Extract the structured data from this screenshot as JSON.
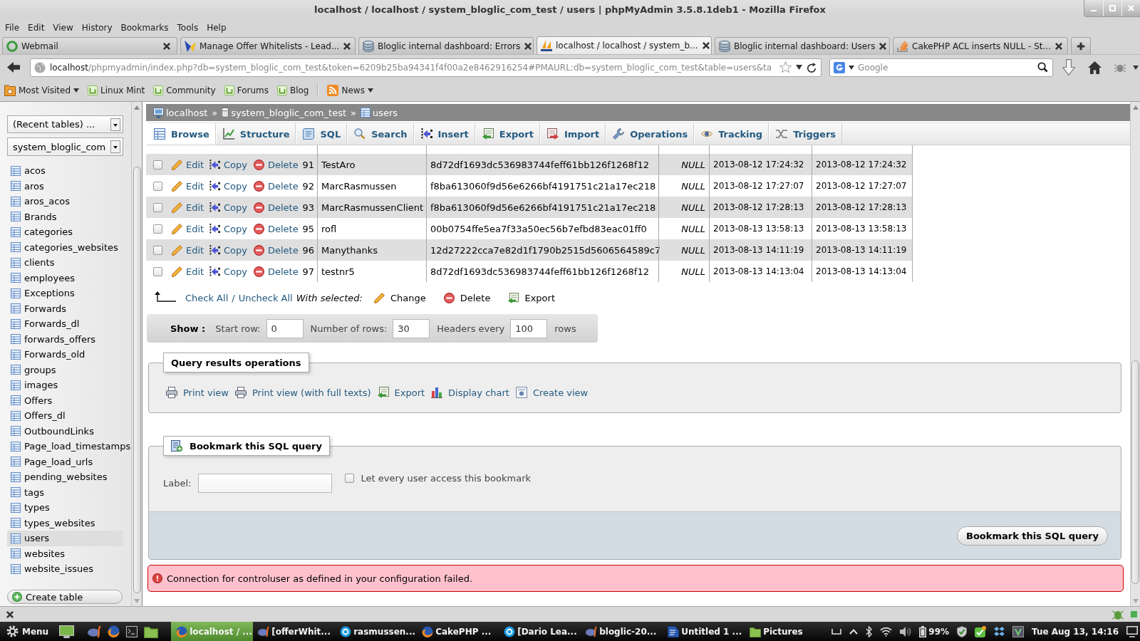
{
  "window": {
    "title": "localhost / localhost / system_bloglic_com_test / users | phpMyAdmin 3.5.8.1deb1 - Mozilla Firefox"
  },
  "menu_bar": [
    "File",
    "Edit",
    "View",
    "History",
    "Bookmarks",
    "Tools",
    "Help"
  ],
  "browser_tabs": [
    {
      "title": "Webmail",
      "selected": false
    },
    {
      "title": "Manage Offer Whitelists - Lead...",
      "selected": false
    },
    {
      "title": "Bloglic internal dashboard: Errors",
      "selected": false
    },
    {
      "title": "localhost / localhost / system_b...",
      "selected": true
    },
    {
      "title": "Bloglic internal dashboard: Users",
      "selected": false
    },
    {
      "title": "CakePHP ACL inserts NULL - St...",
      "selected": false
    }
  ],
  "address_bar": {
    "host": "localhost",
    "path": "/phpmyadmin/index.php?db=system_bloglic_com_test&token=6209b25ba94341f4f00a2e8462916254#PMAURL:db=system_bloglic_com_test&table=users&ta"
  },
  "search_bar": {
    "placeholder": "Google"
  },
  "bookmarks_bar": [
    {
      "kind": "folder",
      "label": "Most Visited"
    },
    {
      "kind": "bookmark",
      "label": "Linux Mint"
    },
    {
      "kind": "bookmark",
      "label": "Community"
    },
    {
      "kind": "bookmark",
      "label": "Forums"
    },
    {
      "kind": "bookmark",
      "label": "Blog"
    },
    {
      "kind": "separator"
    },
    {
      "kind": "feed",
      "label": "News"
    }
  ],
  "sidebar": {
    "recent_tables": "(Recent tables) ...",
    "database": "system_bloglic_com",
    "tables": [
      {
        "name": "acos",
        "selected": false
      },
      {
        "name": "aros",
        "selected": false
      },
      {
        "name": "aros_acos",
        "selected": false
      },
      {
        "name": "Brands",
        "selected": false
      },
      {
        "name": "categories",
        "selected": false
      },
      {
        "name": "categories_websites",
        "selected": false
      },
      {
        "name": "clients",
        "selected": false
      },
      {
        "name": "employees",
        "selected": false
      },
      {
        "name": "Exceptions",
        "selected": false
      },
      {
        "name": "Forwards",
        "selected": false
      },
      {
        "name": "Forwards_dl",
        "selected": false
      },
      {
        "name": "forwards_offers",
        "selected": false
      },
      {
        "name": "Forwards_old",
        "selected": false
      },
      {
        "name": "groups",
        "selected": false
      },
      {
        "name": "images",
        "selected": false
      },
      {
        "name": "Offers",
        "selected": false
      },
      {
        "name": "Offers_dl",
        "selected": false
      },
      {
        "name": "OutboundLinks",
        "selected": false
      },
      {
        "name": "Page_load_timestamps",
        "selected": false
      },
      {
        "name": "Page_load_urls",
        "selected": false
      },
      {
        "name": "pending_websites",
        "selected": false
      },
      {
        "name": "tags",
        "selected": false
      },
      {
        "name": "types",
        "selected": false
      },
      {
        "name": "types_websites",
        "selected": false
      },
      {
        "name": "users",
        "selected": true
      },
      {
        "name": "websites",
        "selected": false
      },
      {
        "name": "website_issues",
        "selected": false
      }
    ],
    "create_table": "Create table"
  },
  "breadcrumb": [
    {
      "label": "localhost"
    },
    {
      "separator": "»",
      "label": "system_bloglic_com_test"
    },
    {
      "separator": "»",
      "label": "users"
    }
  ],
  "table_tabs": [
    {
      "label": "Browse",
      "selected": true
    },
    {
      "label": "Structure",
      "selected": false
    },
    {
      "label": "SQL",
      "selected": false
    },
    {
      "label": "Search",
      "selected": false
    },
    {
      "label": "Insert",
      "selected": false
    },
    {
      "label": "Export",
      "selected": false
    },
    {
      "label": "Import",
      "selected": false
    },
    {
      "label": "Operations",
      "selected": false
    },
    {
      "label": "Tracking",
      "selected": false
    },
    {
      "label": "Triggers",
      "selected": false
    }
  ],
  "rows": [
    {
      "checked": false,
      "actions": [
        "Edit",
        "Copy",
        "Delete"
      ],
      "cells": [
        "91",
        "TestAro",
        "8d72df1693dc536983744feff61bb126f1268f12",
        "NULL",
        "2013-08-12 17:24:32",
        "2013-08-12 17:24:32"
      ]
    },
    {
      "checked": false,
      "actions": [
        "Edit",
        "Copy",
        "Delete"
      ],
      "cells": [
        "92",
        "MarcRasmussen",
        "f8ba613060f9d56e6266bf4191751c21a17ec218",
        "NULL",
        "2013-08-12 17:27:07",
        "2013-08-12 17:27:07"
      ]
    },
    {
      "checked": false,
      "actions": [
        "Edit",
        "Copy",
        "Delete"
      ],
      "cells": [
        "93",
        "MarcRasmussenClient",
        "f8ba613060f9d56e6266bf4191751c21a17ec218",
        "NULL",
        "2013-08-12 17:28:13",
        "2013-08-12 17:28:13"
      ]
    },
    {
      "checked": false,
      "actions": [
        "Edit",
        "Copy",
        "Delete"
      ],
      "cells": [
        "95",
        "rofl",
        "00b0754ffe5ea7f33a50ec56b7efbd83eac01ff0",
        "NULL",
        "2013-08-13 13:58:13",
        "2013-08-13 13:58:13"
      ]
    },
    {
      "checked": false,
      "actions": [
        "Edit",
        "Copy",
        "Delete"
      ],
      "cells": [
        "96",
        "Manythanks",
        "12d27222cca7e82d1f1790b2515d5606564589c7",
        "NULL",
        "2013-08-13 14:11:19",
        "2013-08-13 14:11:19"
      ]
    },
    {
      "checked": false,
      "actions": [
        "Edit",
        "Copy",
        "Delete"
      ],
      "cells": [
        "97",
        "testnr5",
        "8d72df1693dc536983744feff61bb126f1268f12",
        "NULL",
        "2013-08-13 14:13:04",
        "2013-08-13 14:13:04"
      ]
    }
  ],
  "with_selected": {
    "check_all": "Check All",
    "separator": "/",
    "uncheck_all": "Uncheck All",
    "label": "With selected:",
    "actions": [
      "Change",
      "Delete",
      "Export"
    ]
  },
  "show_bar": {
    "title": "Show :",
    "start_row_label": "Start row:",
    "start_row": "0",
    "rows_label": "Number of rows:",
    "rows": "30",
    "headers_label": "Headers every",
    "headers": "100",
    "suffix": "rows"
  },
  "query_results_operations": {
    "legend": "Query results operations",
    "links": [
      "Print view",
      "Print view (with full texts)",
      "Export",
      "Display chart",
      "Create view"
    ]
  },
  "bookmark": {
    "legend": "Bookmark this SQL query",
    "label": "Label:",
    "share_label": "Let every user access this bookmark",
    "share_checked": false,
    "submit": "Bookmark this SQL query"
  },
  "error": {
    "message": "Connection for controluser as defined in your configuration failed."
  },
  "taskbar": {
    "menu": "Menu",
    "tasks": [
      {
        "label": "localhost / ...",
        "selected": true
      },
      {
        "label": "[offerWhit...",
        "selected": false
      },
      {
        "label": "rasmussen...",
        "selected": false
      },
      {
        "label": "CakePHP ...",
        "selected": false
      },
      {
        "label": "[Dario Lea...",
        "selected": false
      },
      {
        "label": "bloglic-20...",
        "selected": false
      },
      {
        "label": "Untitled 1 ...",
        "selected": false
      },
      {
        "label": "Pictures",
        "selected": false
      }
    ],
    "battery": "99%",
    "clock": "Tue Aug 13, 14:16"
  }
}
